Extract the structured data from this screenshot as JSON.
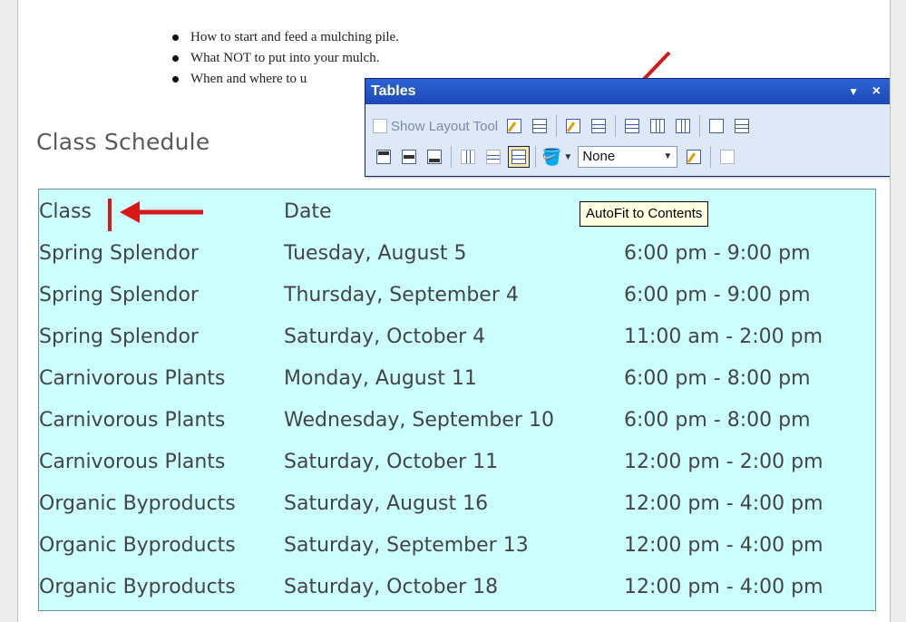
{
  "bullets": [
    "How to start and feed a mulching pile.",
    "What NOT to put into your mulch.",
    "When and where to u"
  ],
  "heading": "Class Schedule",
  "table": {
    "headers": [
      "Class",
      "Date",
      ""
    ],
    "rows": [
      [
        "Spring Splendor",
        "Tuesday, August 5",
        "6:00 pm - 9:00 pm"
      ],
      [
        "Spring Splendor",
        "Thursday, September 4",
        "6:00 pm - 9:00 pm"
      ],
      [
        "Spring Splendor",
        "Saturday, October 4",
        "11:00 am - 2:00 pm"
      ],
      [
        "Carnivorous Plants",
        "Monday, August 11",
        "6:00 pm - 8:00 pm"
      ],
      [
        "Carnivorous Plants",
        "Wednesday, September 10",
        "6:00 pm - 8:00 pm"
      ],
      [
        "Carnivorous Plants",
        "Saturday, October 11",
        "12:00 pm - 2:00 pm"
      ],
      [
        "Organic Byproducts",
        "Saturday, August 16",
        "12:00 pm - 4:00 pm"
      ],
      [
        "Organic Byproducts",
        "Saturday, September 13",
        "12:00 pm - 4:00 pm"
      ],
      [
        "Organic Byproducts",
        "Saturday, October 18",
        "12:00 pm - 4:00 pm"
      ]
    ],
    "background": "#ccffff"
  },
  "toolbar": {
    "title": "Tables",
    "show_layout_tool": "Show Layout Tool",
    "border_style_value": "None",
    "dropdown_caret": "▼",
    "close": "×"
  },
  "tooltip": "AutoFit to Contents",
  "colors": {
    "arrow": "#d81818",
    "titlebar": "#1f48b7"
  }
}
